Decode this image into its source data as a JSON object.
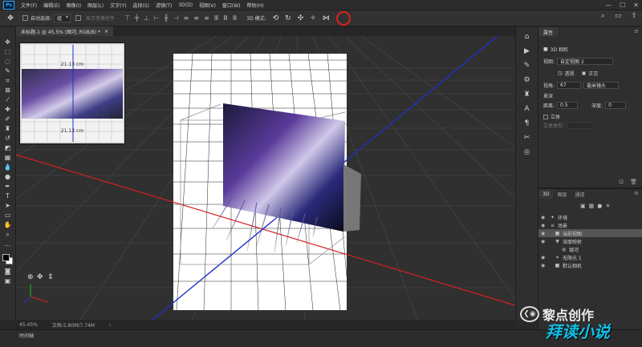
{
  "app": {
    "logo": "Ps"
  },
  "menu": [
    "文件(F)",
    "编辑(E)",
    "图像(I)",
    "图层(L)",
    "文字(Y)",
    "选择(S)",
    "滤镜(T)",
    "3D(D)",
    "视图(V)",
    "窗口(W)",
    "帮助(H)"
  ],
  "window_controls": {
    "minimize": "—",
    "maximize": "☐",
    "close": "✕"
  },
  "options": {
    "auto_select_label": "自动选择:",
    "auto_select_value": "组",
    "show_transform_label": "显示变换控件",
    "mode_label": "3D 模式:"
  },
  "document_tab": {
    "title": "未标题-1 @ 45.5% (图河, RGB/8) *",
    "close": "×"
  },
  "navigator": {
    "top_label": "21.13 cm",
    "bottom_label": "21.13 cm"
  },
  "status": {
    "zoom": "45.45%",
    "doc_info": "文档:5.80M/7.74M",
    "arrow": "›"
  },
  "timeline": {
    "label": "时间轴"
  },
  "properties": {
    "tab": "属性",
    "title": "3D 相机",
    "view_label": "视图:",
    "view_value": "自定视图 2",
    "perspective": "透视",
    "orthographic": "正交",
    "fov_label": "视角:",
    "fov_value": "67",
    "lens_value": "毫米镜头",
    "dof_label": "景深",
    "distance_label": "距离:",
    "distance_value": "0.5",
    "depth_label": "深度:",
    "depth_value": "0",
    "stereo_label": "立体",
    "stereo_type_label": "立体类型:"
  },
  "panel3d": {
    "tabs": [
      "3D",
      "图层",
      "通道"
    ],
    "items": [
      {
        "label": "环境",
        "indent": 1
      },
      {
        "label": "场景",
        "indent": 1
      },
      {
        "label": "当前视图",
        "indent": 2,
        "selected": true
      },
      {
        "label": "深度映射",
        "indent": 2
      },
      {
        "label": "银河",
        "indent": 3
      },
      {
        "label": "无限光 1",
        "indent": 2
      },
      {
        "label": "默认相机",
        "indent": 2
      }
    ]
  },
  "watermark": {
    "text": "黎点创作",
    "icon": "fish-icon",
    "subtext": "拜读小说"
  },
  "colors": {
    "accent_red": "#e02020",
    "axis_red": "#d42020",
    "axis_blue": "#2030c8",
    "grid_white": "#ffffff",
    "selection": "#555555"
  }
}
